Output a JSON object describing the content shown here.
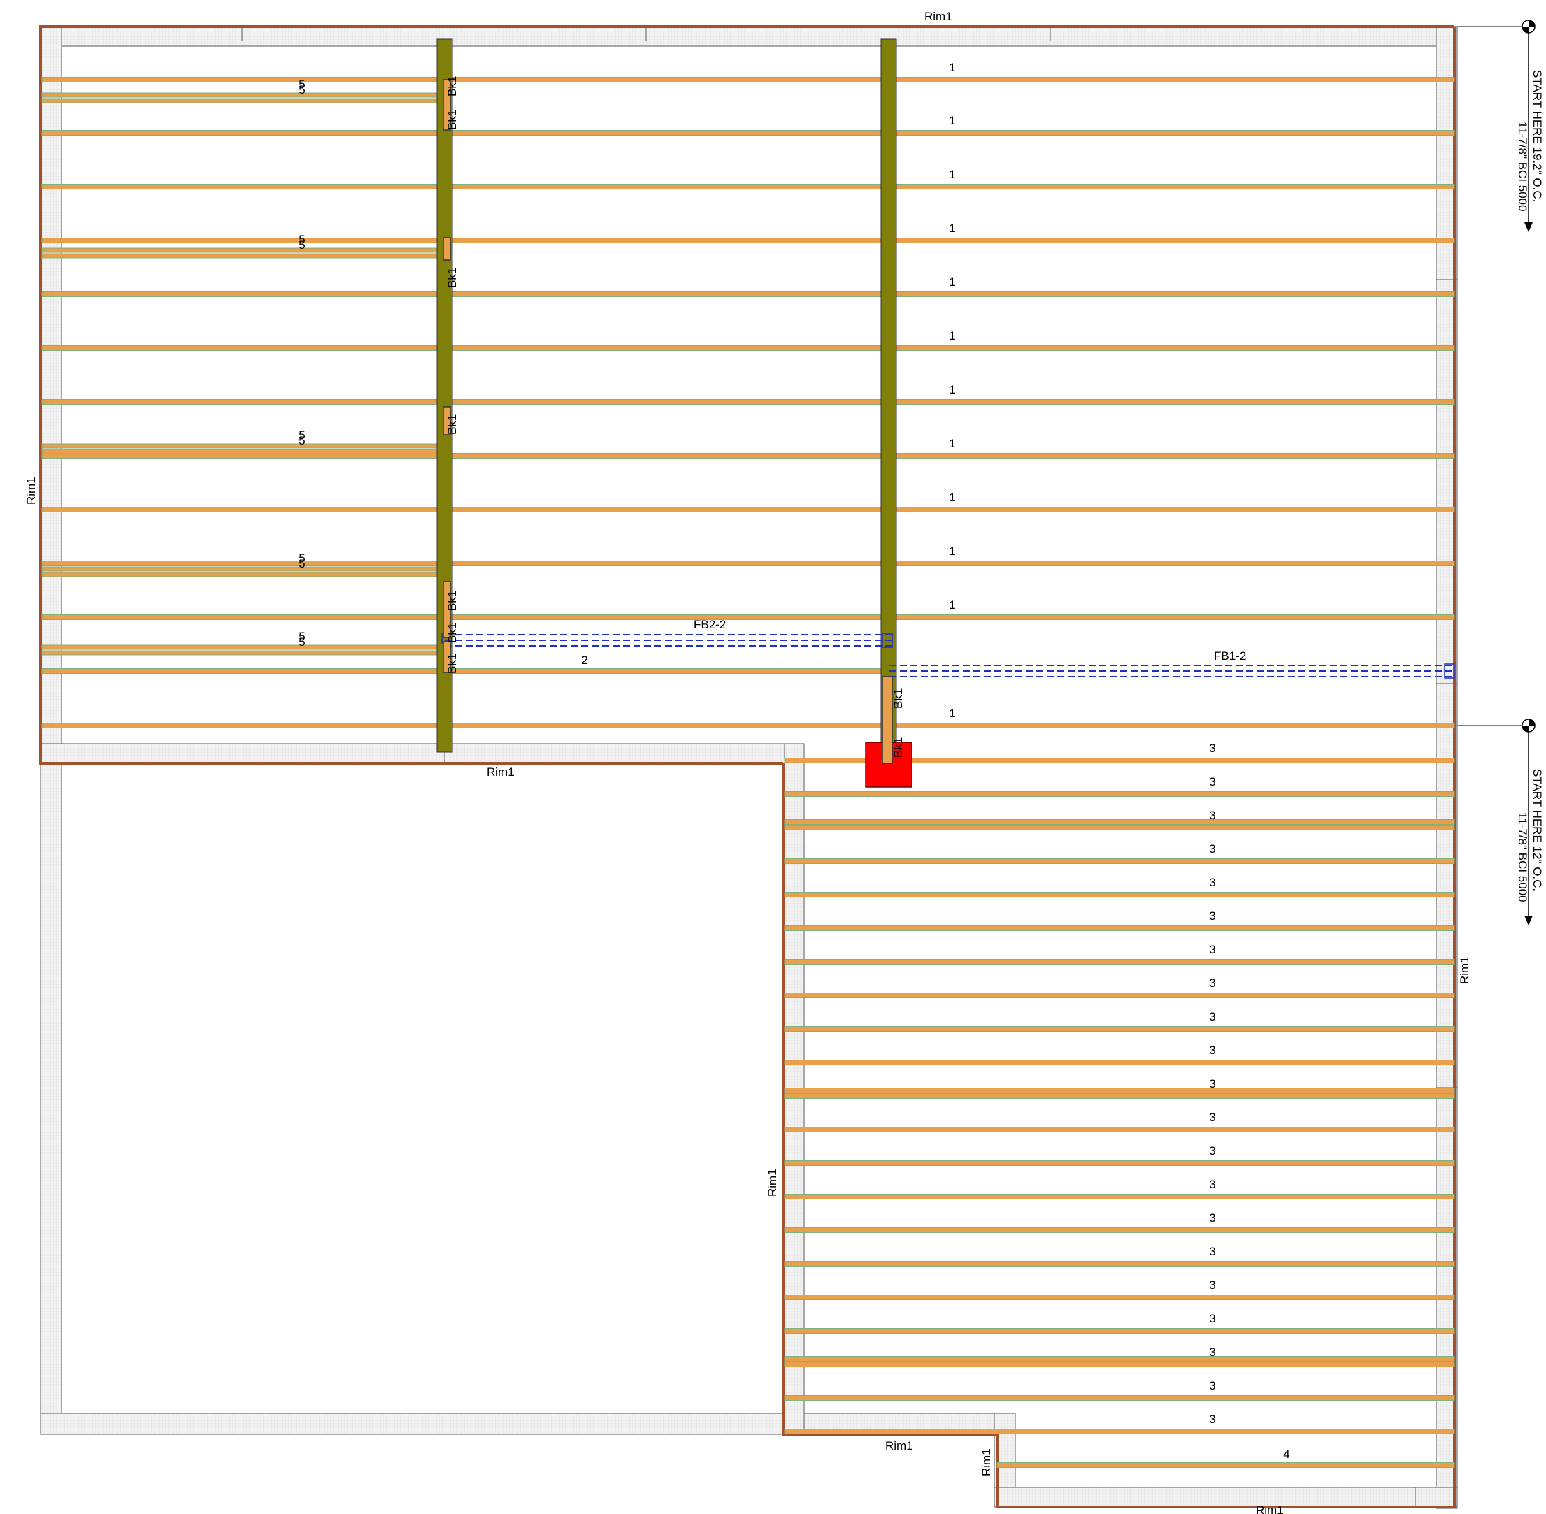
{
  "labels": {
    "rim": "Rim1",
    "block": "Bk1",
    "flush_beam_1": "FB1-2",
    "flush_beam_2": "FB2-2",
    "joist_1": "1",
    "joist_2": "2",
    "joist_3": "3",
    "joist_4": "4",
    "joist_5": "5"
  },
  "notes": {
    "start_upper_line1": "START HERE 19.2\" O.C.",
    "start_upper_line2": "11-7/8\" BCI 5000",
    "start_lower_line1": "START HERE 12\" O.C.",
    "start_lower_line2": "11-7/8\" BCI 5000"
  },
  "colors": {
    "joist": "#E8A04C",
    "joist_edge": "#7FB27F",
    "beam": "#7F7F0A",
    "rim_outline": "#A0522D",
    "flush_beam": "#2030C0",
    "post": "#FF0000",
    "wall_fill": "#EEEEEE"
  },
  "icons": {
    "start_marker": "start-marker-icon"
  }
}
